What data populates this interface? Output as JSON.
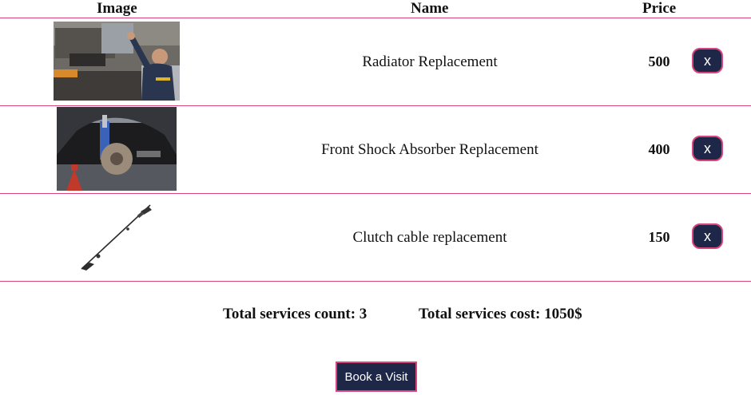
{
  "table": {
    "headers": {
      "image": "Image",
      "name": "Name",
      "price": "Price"
    },
    "rows": [
      {
        "name": "Radiator Replacement",
        "price": "500",
        "remove_label": "x",
        "image_icon": "radiator-replacement-photo"
      },
      {
        "name": "Front Shock Absorber Replacement",
        "price": "400",
        "remove_label": "x",
        "image_icon": "shock-absorber-photo"
      },
      {
        "name": "Clutch cable replacement",
        "price": "150",
        "remove_label": "x",
        "image_icon": "clutch-cable-photo"
      }
    ]
  },
  "summary": {
    "count_text": "Total services count: 3",
    "cost_text": "Total services cost: 1050$"
  },
  "actions": {
    "book_label": "Book a Visit"
  },
  "colors": {
    "button_bg": "#1e2747",
    "accent": "#d9457a",
    "text": "#111111"
  }
}
